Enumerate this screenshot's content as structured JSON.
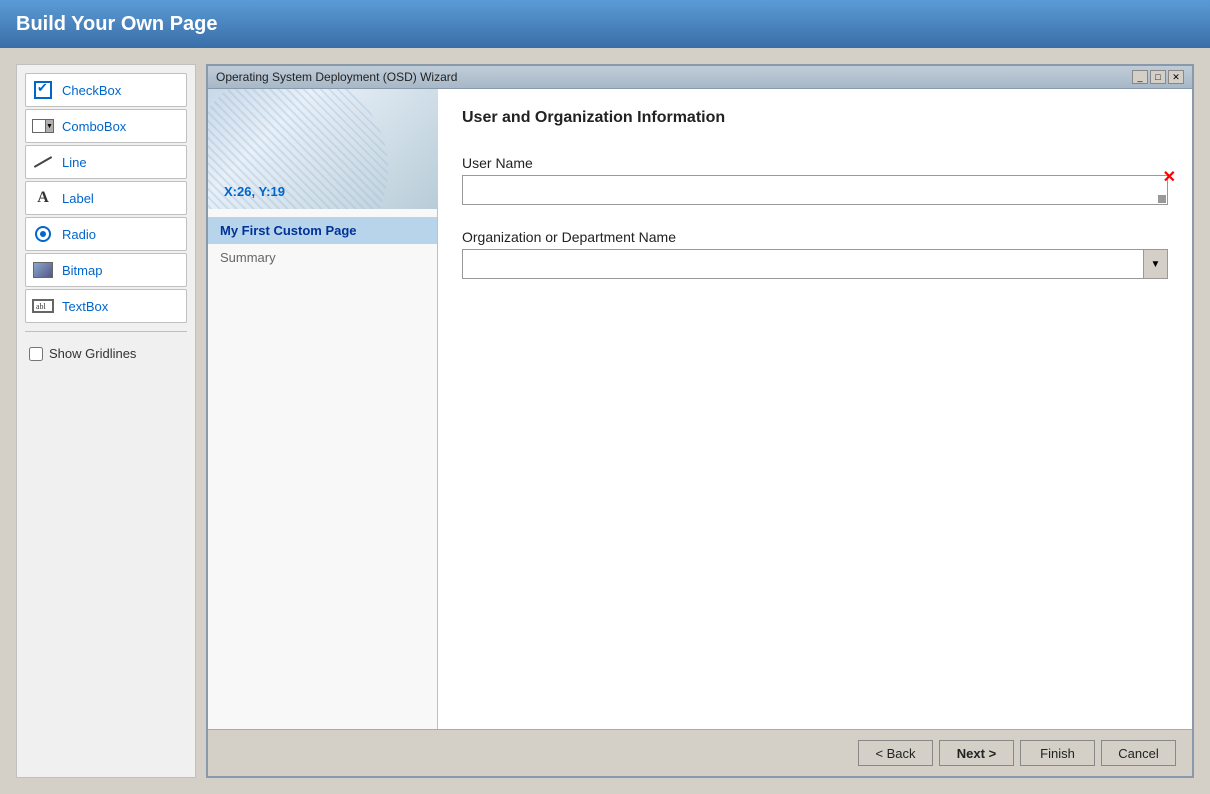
{
  "header": {
    "title": "Build Your Own Page"
  },
  "toolbox": {
    "items": [
      {
        "id": "checkbox",
        "label": "CheckBox",
        "icon": "checkbox-icon"
      },
      {
        "id": "combobox",
        "label": "ComboBox",
        "icon": "combobox-icon"
      },
      {
        "id": "line",
        "label": "Line",
        "icon": "line-icon"
      },
      {
        "id": "label",
        "label": "Label",
        "icon": "label-icon"
      },
      {
        "id": "radio",
        "label": "Radio",
        "icon": "radio-icon"
      },
      {
        "id": "bitmap",
        "label": "Bitmap",
        "icon": "bitmap-icon"
      },
      {
        "id": "textbox",
        "label": "TextBox",
        "icon": "textbox-icon"
      }
    ],
    "show_gridlines_label": "Show Gridlines"
  },
  "wizard": {
    "title": "Operating System Deployment (OSD) Wizard",
    "coords": "X:26, Y:19",
    "nav_items": [
      {
        "id": "custom-page",
        "label": "My First Custom Page",
        "active": true
      },
      {
        "id": "summary",
        "label": "Summary",
        "active": false
      }
    ],
    "section_title": "User and Organization Information",
    "fields": [
      {
        "id": "username",
        "label": "User Name",
        "type": "text",
        "required": true
      },
      {
        "id": "org-name",
        "label": "Organization or Department Name",
        "type": "combobox"
      }
    ],
    "buttons": [
      {
        "id": "back",
        "label": "< Back"
      },
      {
        "id": "next",
        "label": "Next >"
      },
      {
        "id": "finish",
        "label": "Finish"
      },
      {
        "id": "cancel",
        "label": "Cancel"
      }
    ]
  }
}
